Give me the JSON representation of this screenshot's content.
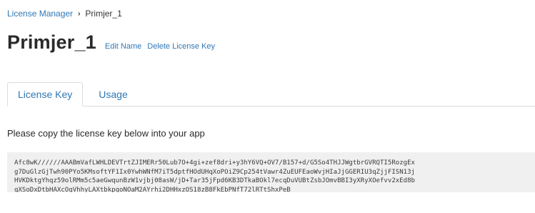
{
  "breadcrumb": {
    "root": "License Manager",
    "separator": "›",
    "current": "Primjer_1"
  },
  "header": {
    "title": "Primjer_1",
    "edit_name": "Edit Name",
    "delete_license_key": "Delete License Key"
  },
  "tabs": [
    {
      "label": "License Key",
      "active": true
    },
    {
      "label": "Usage",
      "active": false
    }
  ],
  "license": {
    "instruction": "Please copy the license key below into your app",
    "key_lines": [
      "Afc8wK//////AAABmVafLWHLDEVTrtZJIMERr50Lub7O+4gi+zef8dri+y3hY6VQ+OV7/B157+d/G5So4THJJWgtbrGVRQTI5RozgEx",
      "g7DuGlzGjTwh90PYo5KMsoftYF1Ix0YwhWNfM7iT5dptfHOdUHqXoPOiZ9Cp254tVawr4ZuEUFEaoWvjHIaJjGGERIU3qZjjFISN13j",
      "HVKDktgYhqz59olRMm5c5aeGwqunBzW1vjbj08asW/jD+Tar35jFpd6KB3DTkaBOkl7ecqDuVUBtZsbJOmvBBI3yXRyXOefvv2xEd8b",
      "qXSoDxDtbHAXcOgVhhyLAXtbkpgoNOaM2AYrhi2DHHxzOS18zB8FkEbPNfT72lRTtShxPeB"
    ]
  },
  "colors": {
    "link": "#2f78b5",
    "key_background": "#f0f0f0",
    "tab_border": "#dcdcdc"
  }
}
